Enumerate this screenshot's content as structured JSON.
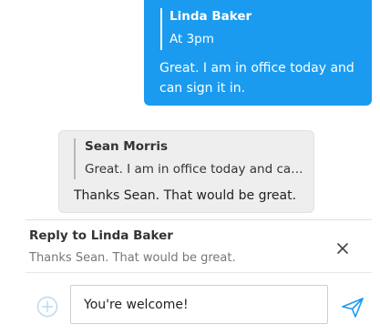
{
  "outgoing_message": {
    "quote_author": "Linda Baker",
    "quote_text": "At 3pm",
    "text": "Great. I am in office today and can sign it in."
  },
  "incoming_message": {
    "quote_author": "Sean Morris",
    "quote_text": "Great. I am in office today and can sign it in.",
    "text": "Thanks Sean. That would be great."
  },
  "reply_banner": {
    "title": "Reply to Linda Baker",
    "text": "Thanks Sean. That would be great."
  },
  "composer": {
    "value": "You're welcome!"
  },
  "icons": {
    "close": "close-icon",
    "add": "add-circle-icon",
    "send": "send-icon"
  },
  "colors": {
    "outgoing_bubble": "#1a9bf0",
    "incoming_bubble": "#eeeeee",
    "send_icon": "#1a9bf0",
    "add_icon": "#b8d8f0"
  }
}
